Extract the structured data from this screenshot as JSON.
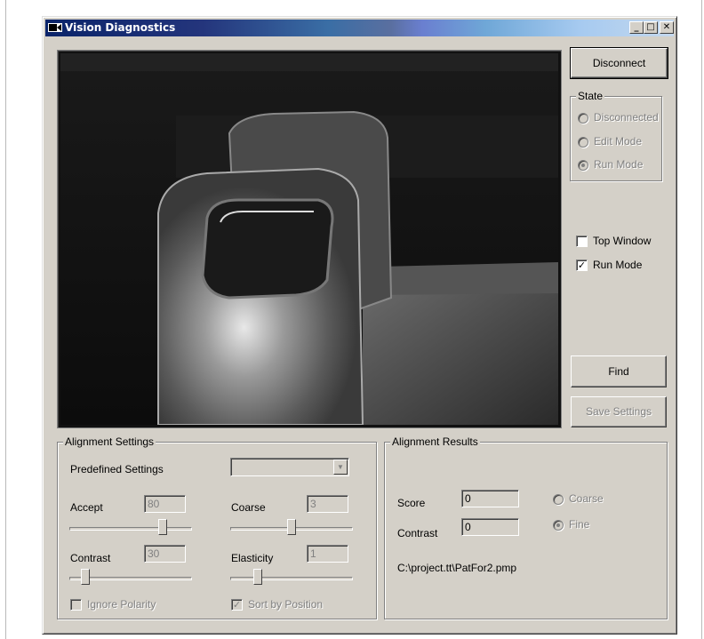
{
  "window": {
    "title": "Vision Diagnostics",
    "title_icon": "camera-icon",
    "controls": {
      "minimize": "_",
      "maximize": "□",
      "close": "✕"
    }
  },
  "camera": {
    "view": "camera-image"
  },
  "buttons": {
    "disconnect": "Disconnect",
    "find": "Find",
    "save_settings": "Save Settings"
  },
  "state": {
    "title": "State",
    "options": [
      "Disconnected",
      "Edit Mode",
      "Run Mode"
    ],
    "selected": "Run Mode"
  },
  "toggles": {
    "top_window": {
      "label": "Top Window",
      "checked": false
    },
    "run_mode": {
      "label": "Run Mode",
      "checked": true,
      "mark": "✓"
    }
  },
  "alignment_settings": {
    "title": "Alignment Settings",
    "predefined_label": "Predefined Settings",
    "predefined_value": "",
    "accept_label": "Accept",
    "accept_value": "80",
    "accept_fraction": 0.78,
    "coarse_label": "Coarse",
    "coarse_value": "3",
    "coarse_fraction": 0.5,
    "contrast_label": "Contrast",
    "contrast_value": "30",
    "contrast_fraction": 0.1,
    "elasticity_label": "Elasticity",
    "elasticity_value": "1",
    "elasticity_fraction": 0.2,
    "ignore_polarity": {
      "label": "Ignore Polarity",
      "checked": false
    },
    "sort_by_position": {
      "label": "Sort by Position",
      "checked": true,
      "mark": "✓"
    }
  },
  "alignment_results": {
    "title": "Alignment Results",
    "score_label": "Score",
    "score_value": "0",
    "contrast_label": "Contrast",
    "contrast_value": "0",
    "options": [
      "Coarse",
      "Fine"
    ],
    "selected": "Fine",
    "file_path": "C:\\project.tt\\PatFor2.pmp"
  },
  "colors": {
    "titlebar_start": "#0a246a",
    "face": "#d4d0c8",
    "disabled_text": "#808080"
  }
}
